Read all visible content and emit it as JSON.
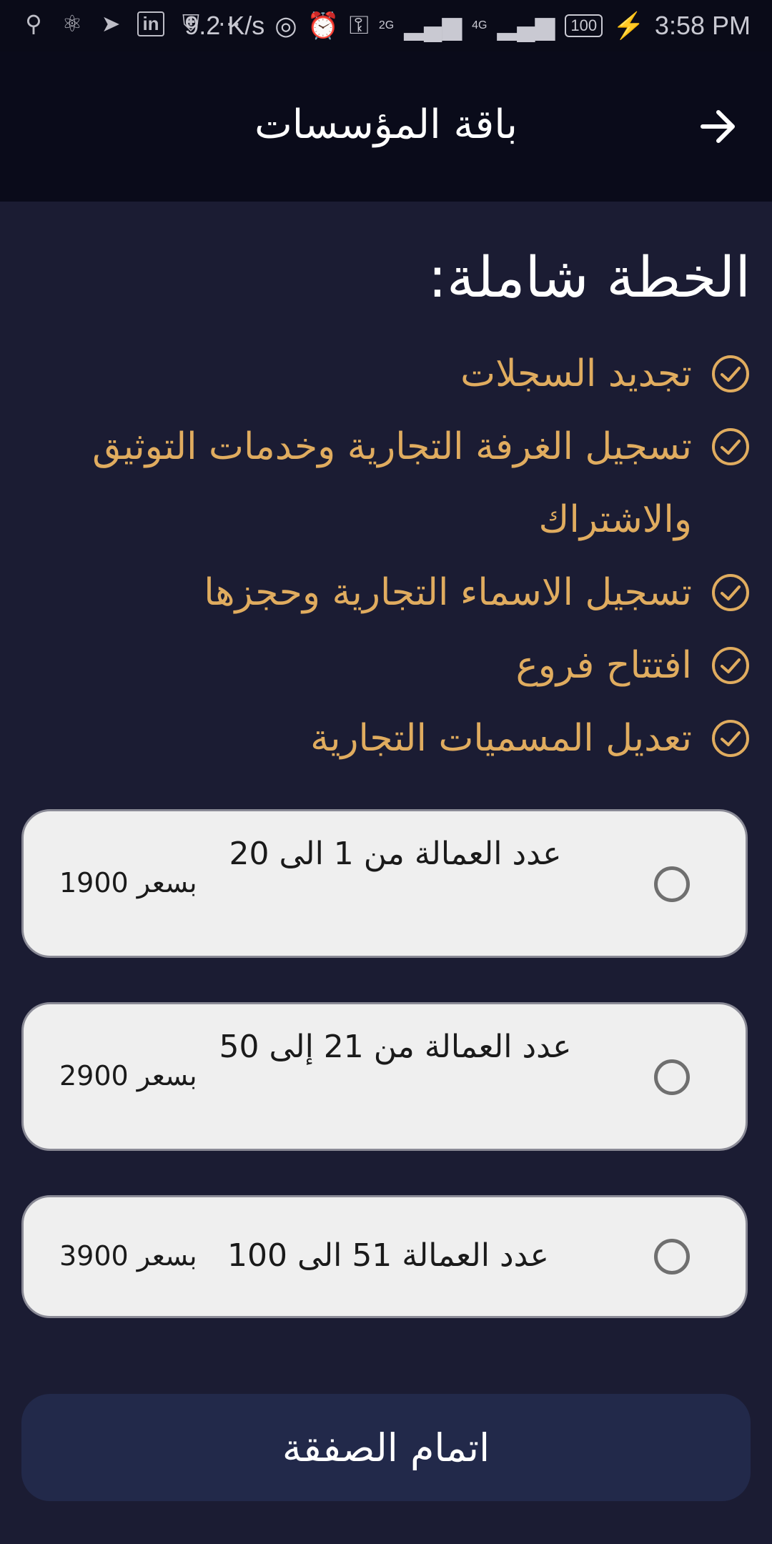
{
  "status_bar": {
    "icons_left": [
      "usb-icon",
      "bug-icon",
      "telegram-icon",
      "linkedin-icon",
      "shield-icon",
      "more-icon"
    ],
    "net_speed": "9.2 K/s",
    "signal_1": "2G",
    "signal_2": "4G",
    "battery": "100",
    "time": "3:58 PM"
  },
  "header": {
    "title": "باقة المؤسسات",
    "back_icon": "arrow-right-icon"
  },
  "plan": {
    "title": "الخطة شاملة:",
    "features": [
      "تجديد السجلات",
      "تسجيل الغرفة التجارية وخدمات التوثيق والاشتراك",
      "تسجيل الاسماء التجارية وحجزها",
      "افتتاح فروع",
      "تعديل المسميات التجارية"
    ]
  },
  "options": [
    {
      "desc": "عدد العمالة  من 1 الى 20",
      "price": "بسعر 1900",
      "selected": false
    },
    {
      "desc": "عدد العمالة من 21 إلى 50",
      "price": "بسعر 2900",
      "selected": false
    },
    {
      "desc": "عدد العمالة 51 الى 100",
      "price": "بسعر 3900",
      "selected": false
    }
  ],
  "cta": {
    "label": "اتمام الصفقة"
  },
  "colors": {
    "background": "#1b1c33",
    "header": "#0a0b1a",
    "feature_text": "#e0ac5f",
    "option_card": "#efefef",
    "cta_button": "#22294a"
  }
}
